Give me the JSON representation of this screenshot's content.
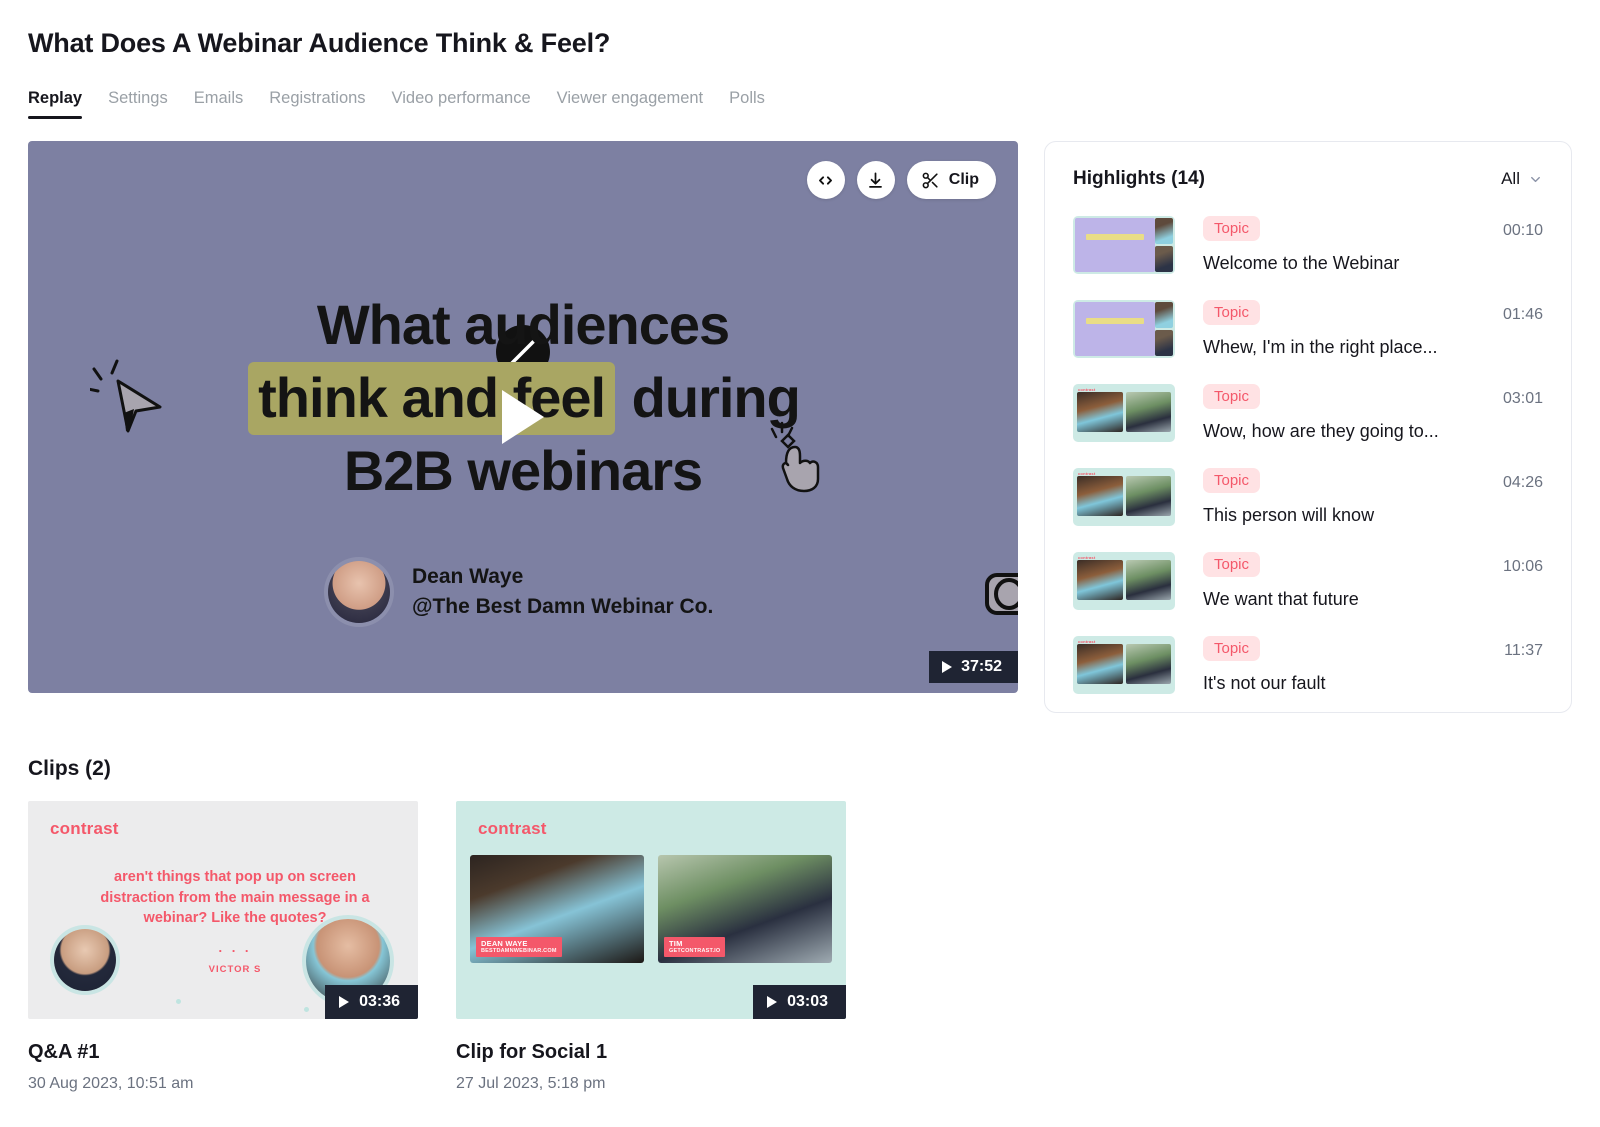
{
  "header": {
    "title": "What Does A Webinar Audience Think & Feel?",
    "tabs": [
      {
        "label": "Replay",
        "active": true
      },
      {
        "label": "Settings",
        "active": false
      },
      {
        "label": "Emails",
        "active": false
      },
      {
        "label": "Registrations",
        "active": false
      },
      {
        "label": "Video performance",
        "active": false
      },
      {
        "label": "Viewer engagement",
        "active": false
      },
      {
        "label": "Polls",
        "active": false
      }
    ]
  },
  "player": {
    "controls": {
      "embed_icon": "code-brackets-icon",
      "download_icon": "download-icon",
      "clip_label": "Clip",
      "clip_icon": "scissors-icon"
    },
    "slide": {
      "line1": "What audiences",
      "line2_highlight": "think and feel",
      "line2_rest": "during",
      "line3": "B2B webinars",
      "presenter_name": "Dean Waye",
      "presenter_org": "@The Best Damn Webinar Co."
    },
    "duration": "37:52",
    "background_color": "#7d80a2",
    "highlight_color": "#a9a663"
  },
  "highlights": {
    "title": "Highlights (14)",
    "filter_label": "All",
    "count": 14,
    "badge_color": "#f4586a",
    "items": [
      {
        "badge": "Topic",
        "text": "Welcome to the Webinar",
        "time": "00:10",
        "thumb": "slide"
      },
      {
        "badge": "Topic",
        "text": "Whew, I'm in the right place...",
        "time": "01:46",
        "thumb": "slide"
      },
      {
        "badge": "Topic",
        "text": "Wow, how are they going to...",
        "time": "03:01",
        "thumb": "pair"
      },
      {
        "badge": "Topic",
        "text": "This person will know",
        "time": "04:26",
        "thumb": "pair"
      },
      {
        "badge": "Topic",
        "text": "We want that future",
        "time": "10:06",
        "thumb": "pair"
      },
      {
        "badge": "Topic",
        "text": "It's not our fault",
        "time": "11:37",
        "thumb": "pair"
      }
    ]
  },
  "clips": {
    "title": "Clips (2)",
    "items": [
      {
        "name": "Q&A #1",
        "date": "30 Aug 2023, 10:51 am",
        "duration": "03:36",
        "style": "quote",
        "logo": "contrast",
        "quote": "aren't things that pop up on screen distraction from the main message in a webinar? Like the quotes?",
        "quote_dots": ". . .",
        "quote_author": "VICTOR S"
      },
      {
        "name": "Clip for Social 1",
        "date": "27 Jul 2023, 5:18 pm",
        "duration": "03:03",
        "style": "cams",
        "logo": "contrast",
        "cam_a_name": "DEAN WAYE",
        "cam_a_handle": "BESTDAMNWEBINAR.COM",
        "cam_b_name": "TIM",
        "cam_b_handle": "GETCONTRAST.IO"
      }
    ]
  }
}
